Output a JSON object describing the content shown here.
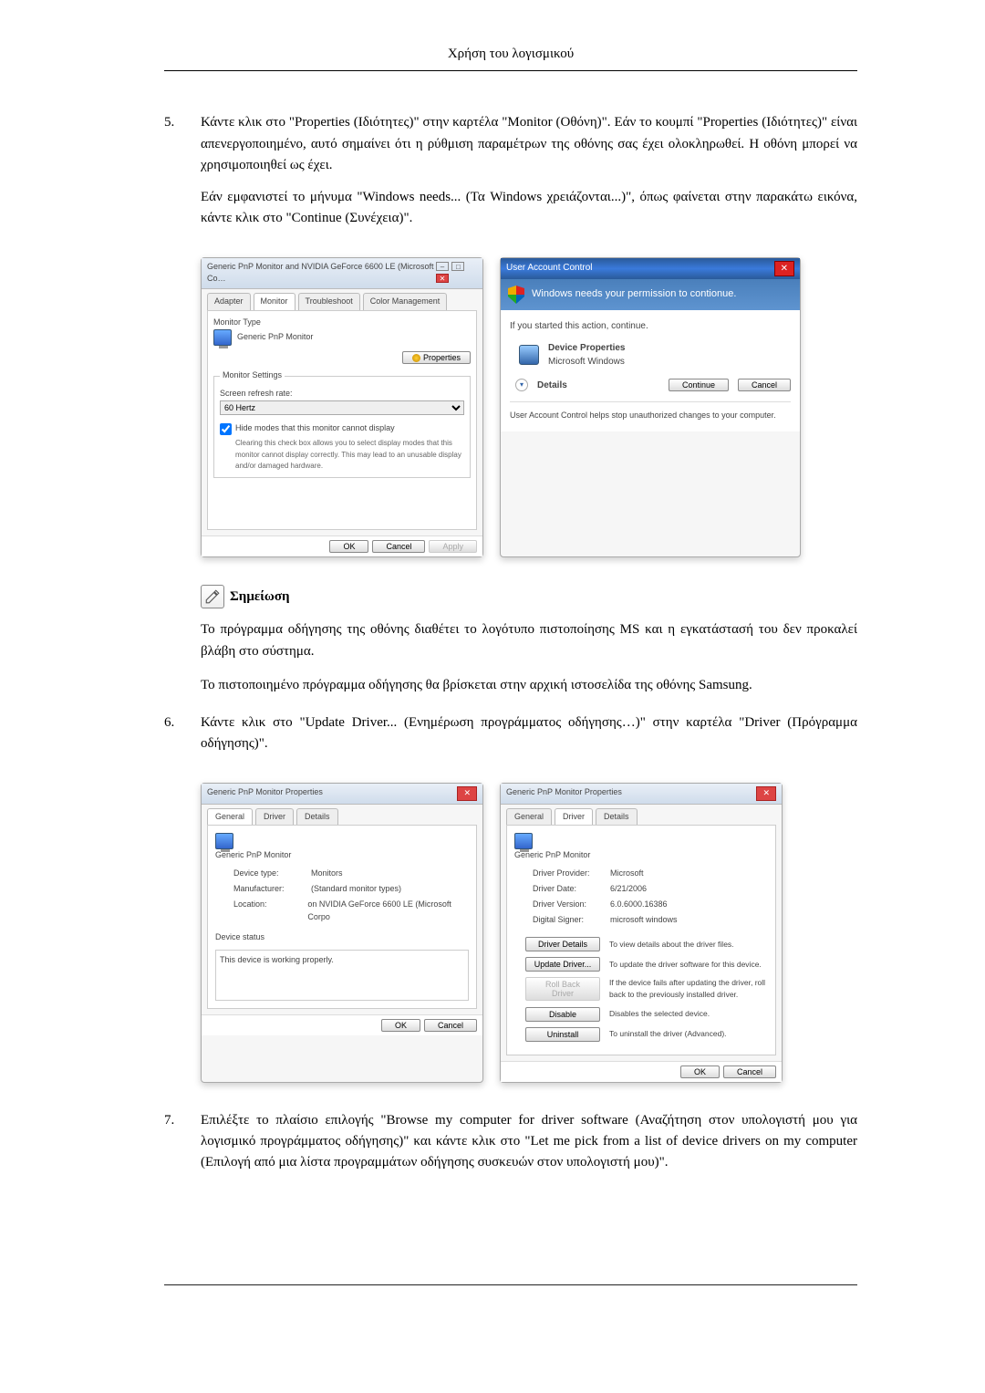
{
  "header": {
    "title": "Χρήση του λογισμικού"
  },
  "steps": {
    "s5": {
      "num": "5.",
      "p1": "Κάντε κλικ στο \"Properties (Ιδιότητες)\" στην καρτέλα \"Monitor (Οθόνη)\". Εάν το κουμπί \"Properties (Ιδιότητες)\" είναι απενεργοποιημένο, αυτό σημαίνει ότι η ρύθμιση παραμέτρων της οθόνης σας έχει ολοκληρωθεί. Η οθόνη μπορεί να χρησιμοποιηθεί ως έχει.",
      "p2": "Εάν εμφανιστεί το μήνυμα \"Windows needs... (Τα Windows χρειάζονται...)\", όπως φαίνεται στην παρακάτω εικόνα, κάντε κλικ στο \"Continue (Συνέχεια)\"."
    },
    "s6": {
      "num": "6.",
      "p1": "Κάντε κλικ στο \"Update Driver... (Ενημέρωση προγράμματος οδήγησης…)\" στην καρτέλα \"Driver (Πρόγραμμα οδήγησης)\"."
    },
    "s7": {
      "num": "7.",
      "p1": "Επιλέξτε το πλαίσιο επιλογής \"Browse my computer for driver software (Αναζήτηση στον υπολογιστή μου για λογισμικό προγράμματος οδήγησης)\" και κάντε κλικ στο \"Let me pick from a list of device drivers on my computer (Επιλογή από μια λίστα προγραμμάτων οδήγησης συσκευών στον υπολογιστή μου)\"."
    }
  },
  "note": {
    "label": "Σημείωση",
    "p1": "Το πρόγραμμα οδήγησης της οθόνης διαθέτει το λογότυπο πιστοποίησης MS και η εγκατάστασή του δεν προκαλεί βλάβη στο σύστημα.",
    "p2": "Το πιστοποιημένο πρόγραμμα οδήγησης θα βρίσκεται στην αρχική ιστοσελίδα της οθόνης Samsung."
  },
  "dlg1": {
    "title": "Generic PnP Monitor and NVIDIA GeForce 6600 LE (Microsoft Co…",
    "tabs": {
      "adapter": "Adapter",
      "monitor": "Monitor",
      "trouble": "Troubleshoot",
      "color": "Color Management"
    },
    "monType": "Monitor Type",
    "monName": "Generic PnP Monitor",
    "propBtn": "Properties",
    "settings": "Monitor Settings",
    "refresh": "Screen refresh rate:",
    "hz": "60 Hertz",
    "chk": "Hide modes that this monitor cannot display",
    "chkDesc": "Clearing this check box allows you to select display modes that this monitor cannot display correctly. This may lead to an unusable display and/or damaged hardware.",
    "ok": "OK",
    "cancel": "Cancel",
    "apply": "Apply"
  },
  "dlg2": {
    "title": "User Account Control",
    "close": "✕",
    "bar": "Windows needs your permission to contionue.",
    "started": "If you started this action, continue.",
    "item1": "Device Properties",
    "item2": "Microsoft Windows",
    "details": "Details",
    "continue": "Continue",
    "cancel": "Cancel",
    "note": "User Account Control helps stop unauthorized changes to your computer."
  },
  "dlg3": {
    "title": "Generic PnP Monitor Properties",
    "tabs": {
      "general": "General",
      "driver": "Driver",
      "details": "Details"
    },
    "monName": "Generic PnP Monitor",
    "devType": "Device type:",
    "devTypeV": "Monitors",
    "manuf": "Manufacturer:",
    "manufV": "(Standard monitor types)",
    "loc": "Location:",
    "locV": "on NVIDIA GeForce 6600 LE (Microsoft Corpo",
    "status": "Device status",
    "statusV": "This device is working properly.",
    "ok": "OK",
    "cancel": "Cancel"
  },
  "dlg4": {
    "title": "Generic PnP Monitor Properties",
    "tabs": {
      "general": "General",
      "driver": "Driver",
      "details": "Details"
    },
    "monName": "Generic PnP Monitor",
    "prov": "Driver Provider:",
    "provV": "Microsoft",
    "date": "Driver Date:",
    "dateV": "6/21/2006",
    "ver": "Driver Version:",
    "verV": "6.0.6000.16386",
    "sig": "Digital Signer:",
    "sigV": "microsoft windows",
    "b1": "Driver Details",
    "b1t": "To view details about the driver files.",
    "b2": "Update Driver...",
    "b2t": "To update the driver software for this device.",
    "b3": "Roll Back Driver",
    "b3t": "If the device fails after updating the driver, roll back to the previously installed driver.",
    "b4": "Disable",
    "b4t": "Disables the selected device.",
    "b5": "Uninstall",
    "b5t": "To uninstall the driver (Advanced).",
    "ok": "OK",
    "cancel": "Cancel"
  }
}
